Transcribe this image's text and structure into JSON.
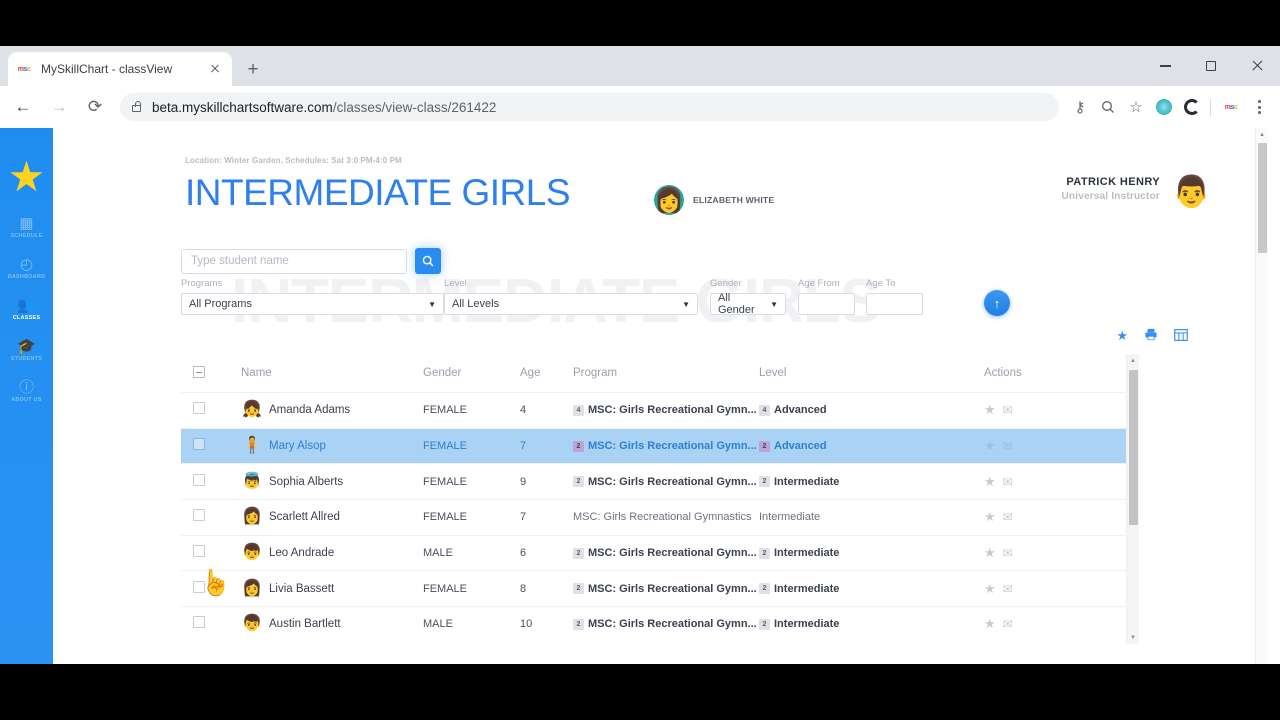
{
  "browser": {
    "tab": {
      "title": "MySkillChart - classView",
      "favicon": "msc-logo-icon",
      "close": "✕"
    },
    "newtab_label": "+",
    "url_main": "beta.myskillchartsoftware.com",
    "url_path": "/classes/view-class/261422",
    "icons": {
      "back": "←",
      "forward": "→",
      "reload": "⟳",
      "key": "⚷",
      "search": "🔍",
      "bookmark": "☆",
      "menu": "⋮",
      "ext_hex": "hexagon-extension-icon",
      "ext_spiral": "spiral-extension-icon",
      "ext_msc": "msc-extension-icon"
    },
    "window": {
      "minimize": "—",
      "maximize": "▢",
      "close": "✕"
    }
  },
  "sidebar": {
    "logo": "★",
    "items": [
      {
        "label": "SCHEDULE",
        "icon": "▦",
        "active": false
      },
      {
        "label": "DASHBOARD",
        "icon": "◴",
        "active": false
      },
      {
        "label": "CLASSES",
        "icon": "👥",
        "active": true
      },
      {
        "label": "STUDENTS",
        "icon": "🎓",
        "active": false
      },
      {
        "label": "ABOUT US",
        "icon": "ⓘ",
        "active": false
      }
    ]
  },
  "header": {
    "location_line": "Location: Winter Garden, Schedules: Sat 3:0 PM-4:0 PM",
    "class_title": "INTERMEDIATE GIRLS",
    "watermark": "INTERMEDIATE GIRLS",
    "teacher_name": "ELIZABETH WHITE",
    "teacher_avatar": "👩",
    "instructor_name": "PATRICK HENRY",
    "instructor_role": "Universal Instructor",
    "instructor_avatar": "👨"
  },
  "search": {
    "placeholder": "Type student name",
    "value": "",
    "button_icon": "🔍"
  },
  "filters": {
    "programs": {
      "label": "Programs",
      "value": "All Programs",
      "caret": "▼"
    },
    "level": {
      "label": "Level",
      "value": "All Levels",
      "caret": "▼"
    },
    "gender": {
      "label": "Gender",
      "value": "All Gender",
      "caret": "▼"
    },
    "age_from": {
      "label": "Age From",
      "value": ""
    },
    "age_to": {
      "label": "Age To",
      "value": ""
    },
    "go_icon": "↑"
  },
  "table_toolbar": {
    "favorite_icon": "★",
    "print_icon": "🖨",
    "grid_icon": "▦"
  },
  "table": {
    "columns": [
      "",
      "Name",
      "Gender",
      "Age",
      "Program",
      "Level",
      "Actions"
    ],
    "header_checkbox_state": "indeterminate",
    "rows": [
      {
        "avatar": "👧",
        "name": "Amanda Adams",
        "gender": "FEMALE",
        "age": "4",
        "program_badge": "4",
        "program": "MSC: Girls Recreational Gymn...",
        "level_badge": "4",
        "level": "Advanced",
        "selected": false,
        "bold": true
      },
      {
        "avatar": "🧍",
        "name": "Mary Alsop",
        "gender": "FEMALE",
        "age": "7",
        "program_badge": "2",
        "program": "MSC: Girls Recreational Gymn...",
        "level_badge": "2",
        "level": "Advanced",
        "selected": true,
        "bold": true
      },
      {
        "avatar": "👼",
        "name": "Sophia Alberts",
        "gender": "FEMALE",
        "age": "9",
        "program_badge": "2",
        "program": "MSC: Girls Recreational Gymn...",
        "level_badge": "2",
        "level": "Intermediate",
        "selected": false,
        "bold": true
      },
      {
        "avatar": "👩",
        "name": "Scarlett Allred",
        "gender": "FEMALE",
        "age": "7",
        "program_badge": "",
        "program": "MSC: Girls Recreational Gymnastics",
        "level_badge": "",
        "level": "Intermediate",
        "selected": false,
        "bold": false
      },
      {
        "avatar": "👦",
        "name": "Leo Andrade",
        "gender": "MALE",
        "age": "6",
        "program_badge": "2",
        "program": "MSC: Girls Recreational Gymn...",
        "level_badge": "2",
        "level": "Intermediate",
        "selected": false,
        "bold": true
      },
      {
        "avatar": "👩",
        "name": "Livia Bassett",
        "gender": "FEMALE",
        "age": "8",
        "program_badge": "2",
        "program": "MSC: Girls Recreational Gymn...",
        "level_badge": "2",
        "level": "Intermediate",
        "selected": false,
        "bold": true
      },
      {
        "avatar": "👦",
        "name": "Austin Bartlett",
        "gender": "MALE",
        "age": "10",
        "program_badge": "2",
        "program": "MSC: Girls Recreational Gymn...",
        "level_badge": "2",
        "level": "Intermediate",
        "selected": false,
        "bold": true
      }
    ],
    "row_actions": {
      "star_icon": "★",
      "mail_icon": "✉"
    }
  },
  "colors": {
    "accent_blue": "#2f80ed",
    "sidebar_blue": "#2b93f2",
    "selected_row": "#a9d2f5",
    "star_yellow": "#ffd21f"
  }
}
